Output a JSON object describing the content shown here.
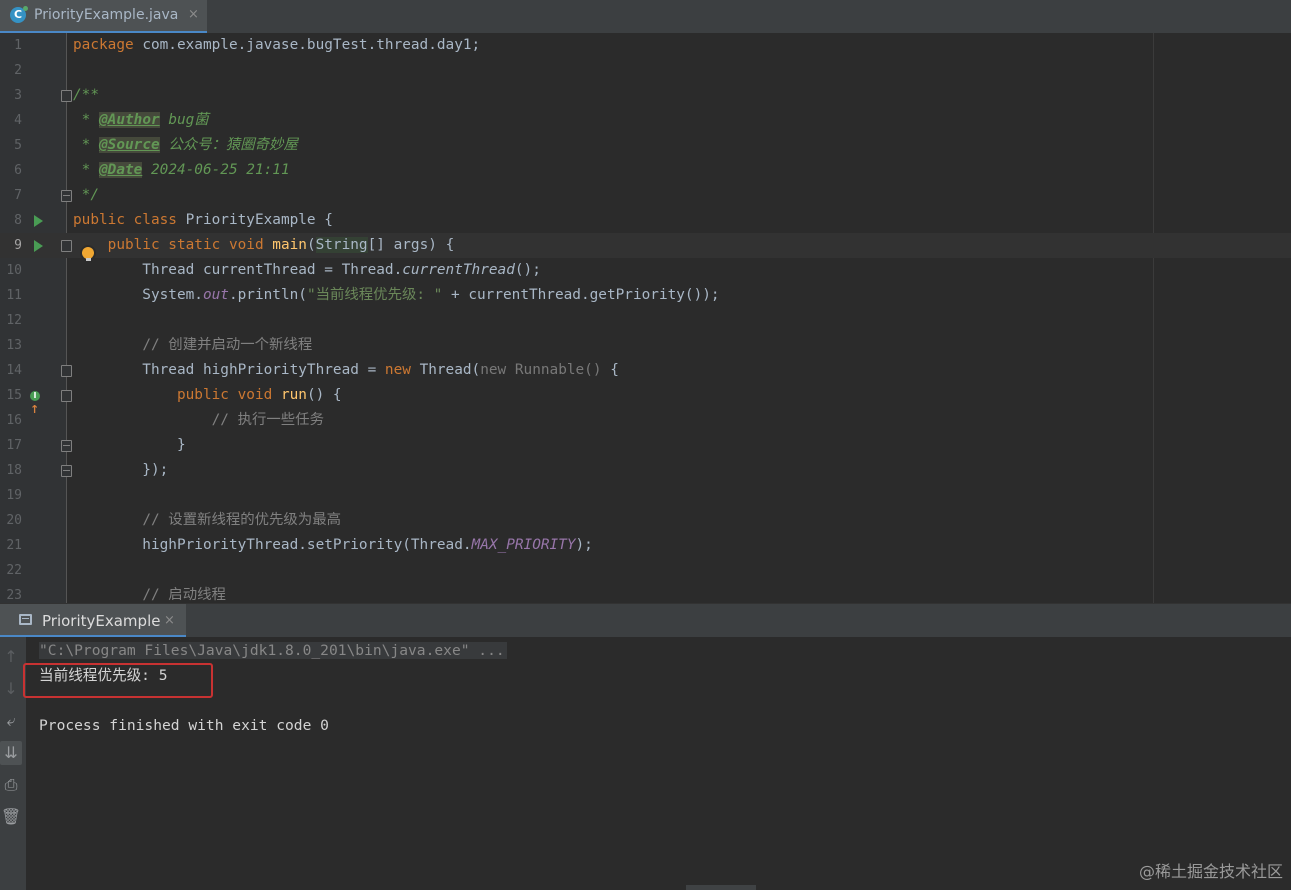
{
  "editor_tab": {
    "icon_name": "java-class-icon",
    "icon_letter": "C",
    "label": "PriorityExample.java",
    "close": "×"
  },
  "editor": {
    "lines": [
      {
        "n": "1",
        "html": "<span class=\"kw\">package </span>com.example.javase.bugTest.thread.day1;"
      },
      {
        "n": "2",
        "html": ""
      },
      {
        "n": "3",
        "html": "<span class=\"doc\">/**</span>"
      },
      {
        "n": "4",
        "html": "<span class=\"doc\"> * </span><span class=\"tag\">@Author</span><span class=\"doc\"> bug菌</span>"
      },
      {
        "n": "5",
        "html": "<span class=\"doc\"> * </span><span class=\"tag\">@Source</span><span class=\"doc\"> 公众号：猿圈奇妙屋</span>"
      },
      {
        "n": "6",
        "html": "<span class=\"doc\"> * </span><span class=\"tag\">@Date</span><span class=\"doc\"> 2024-06-25 21:11</span>"
      },
      {
        "n": "7",
        "html": "<span class=\"doc\"> */</span>"
      },
      {
        "n": "8",
        "html": "<span class=\"kw\">public class </span>PriorityExample {"
      },
      {
        "n": "9",
        "html": "    <span class=\"kw\">public static void </span><span class=\"fn\">main</span>(<span class=\"hl\">String</span>[] args) {"
      },
      {
        "n": "10",
        "html": "        Thread currentThread = Thread.<span class=\"itl\">currentThread</span>();"
      },
      {
        "n": "11",
        "html": "        System.<span class=\"st\">out</span>.println(<span class=\"str\">\"当前线程优先级: \"</span> + currentThread.getPriority());"
      },
      {
        "n": "12",
        "html": ""
      },
      {
        "n": "13",
        "html": "        <span class=\"cm\">// 创建并启动一个新线程</span>"
      },
      {
        "n": "14",
        "html": "        Thread highPriorityThread = <span class=\"kw\">new </span>Thread(<span class=\"hint\">new Runnable() </span>{"
      },
      {
        "n": "15",
        "html": "            <span class=\"kw\">public void </span><span class=\"fn\">run</span>() {"
      },
      {
        "n": "16",
        "html": "                <span class=\"cm\">// 执行一些任务</span>"
      },
      {
        "n": "17",
        "html": "            }"
      },
      {
        "n": "18",
        "html": "        });"
      },
      {
        "n": "19",
        "html": ""
      },
      {
        "n": "20",
        "html": "        <span class=\"cm\">// 设置新线程的优先级为最高</span>"
      },
      {
        "n": "21",
        "html": "        highPriorityThread.setPriority(Thread.<span class=\"st\">MAX_PRIORITY</span>);"
      },
      {
        "n": "22",
        "html": ""
      },
      {
        "n": "23",
        "html": "        <span class=\"cm\">// 启动线程</span>"
      }
    ],
    "current_line": "9",
    "run_lines": [
      "8",
      "9"
    ],
    "override_lines": [
      "15"
    ],
    "fold_open_lines": [
      "3",
      "9",
      "14",
      "15"
    ],
    "fold_close_lines": [
      "7",
      "17",
      "18"
    ],
    "bulb_line": "8"
  },
  "run_window": {
    "tab_label": "PriorityExample",
    "tab_icon": "console-icon",
    "close": "×",
    "tools": [
      {
        "name": "scroll-up-icon",
        "glyph": "↑",
        "dim": true
      },
      {
        "name": "scroll-down-icon",
        "glyph": "↓",
        "dim": true
      },
      {
        "name": "soft-wrap-icon",
        "glyph": "⤶",
        "dim": false
      },
      {
        "name": "scroll-to-end-icon",
        "glyph": "⇊",
        "dim": false,
        "active": true
      },
      {
        "name": "print-icon",
        "glyph": "⎙",
        "dim": false
      },
      {
        "name": "trash-icon",
        "glyph": "🗑",
        "dim": false
      }
    ],
    "command": "\"C:\\Program Files\\Java\\jdk1.8.0_201\\bin\\java.exe\" ...",
    "output": "当前线程优先级: 5",
    "finished": "Process finished with exit code 0"
  },
  "watermark": "@稀土掘金技术社区"
}
